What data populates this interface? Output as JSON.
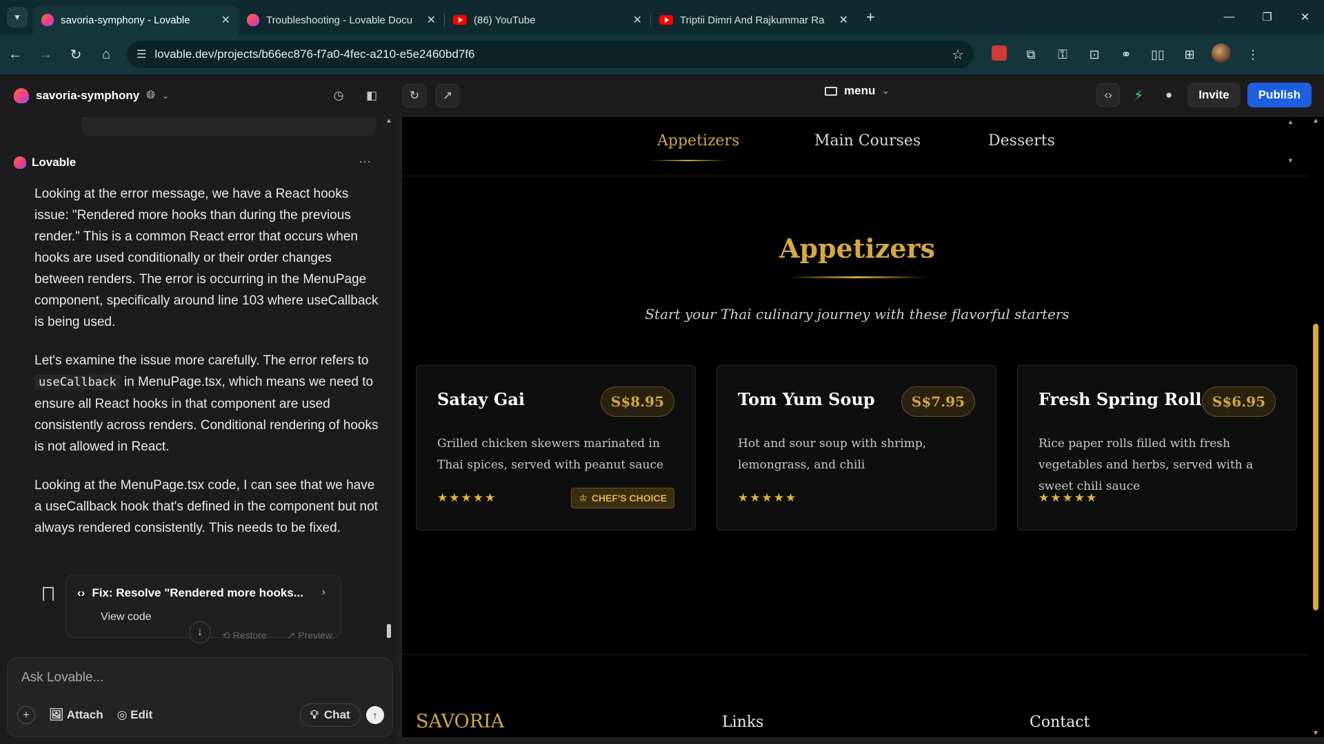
{
  "browser": {
    "tabs": [
      {
        "title": "savoria-symphony - Lovable",
        "favicon": "lovable-icon",
        "active": true
      },
      {
        "title": "Troubleshooting - Lovable Docu",
        "favicon": "lovable-icon",
        "active": false
      },
      {
        "title": "(86) YouTube",
        "favicon": "youtube-icon",
        "active": false
      },
      {
        "title": "Triptii Dimri And Rajkummar Ra",
        "favicon": "youtube-icon",
        "active": false
      }
    ],
    "url": "lovable.dev/projects/b66ec876-f7a0-4fec-a210-e5e2460bd7f6"
  },
  "app": {
    "project_name": "savoria-symphony",
    "page_selector": "menu",
    "invite_label": "Invite",
    "publish_label": "Publish"
  },
  "chat": {
    "sender": "Lovable",
    "paragraphs": [
      "Looking at the error message, we have a React hooks issue: \"Rendered more hooks than during the previous render.\" This is a common React error that occurs when hooks are used conditionally or their order changes between renders. The error is occurring in the MenuPage component, specifically around line 103 where useCallback is being used.",
      "Looking at the MenuPage.tsx code, I can see that we have a useCallback hook that's defined in the component but not always rendered consistently. This needs to be fixed."
    ],
    "p2": {
      "a": "Let's examine the issue more carefully. The error refers to",
      "code": "useCallback",
      "b": "in MenuPage.tsx, which means we need to ensure all React hooks in that component are used consistently across renders. Conditional rendering of hooks is not allowed in React."
    },
    "fix_card": {
      "title": "Fix: Resolve \"Rendered more hooks...",
      "action": "View code"
    },
    "restore_label": "Restore",
    "preview_label": "Preview",
    "composer": {
      "placeholder": "Ask Lovable...",
      "attach": "Attach",
      "edit": "Edit",
      "chat": "Chat"
    }
  },
  "site": {
    "nav": [
      "Appetizers",
      "Main Courses",
      "Desserts"
    ],
    "section_title": "Appetizers",
    "section_subtitle": "Start your Thai culinary journey with these flavorful starters",
    "items": [
      {
        "name": "Satay Gai",
        "price": "S$8.95",
        "description": "Grilled chicken skewers marinated in Thai spices, served with peanut sauce",
        "rating": 5,
        "badge": "CHEF'S CHOICE"
      },
      {
        "name": "Tom Yum Soup",
        "price": "S$7.95",
        "description": "Hot and sour soup with shrimp, lemongrass, and chili",
        "rating": 5,
        "badge": ""
      },
      {
        "name": "Fresh Spring Rolls",
        "price": "S$6.95",
        "description": "Rice paper rolls filled with fresh vegetables and herbs, served with a sweet chili sauce",
        "rating": 5,
        "badge": ""
      }
    ],
    "footer": {
      "brand": "SAVORIA",
      "links": "Links",
      "contact": "Contact"
    },
    "accent_color": "#d4a843"
  }
}
